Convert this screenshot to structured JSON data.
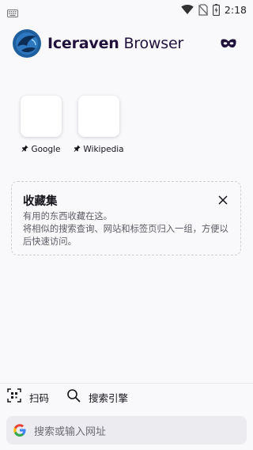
{
  "status_bar": {
    "time": "2:18",
    "icons": [
      "keyboard-icon",
      "wifi-icon",
      "no-sim-icon",
      "battery-icon"
    ]
  },
  "header": {
    "brand_bold": "Iceraven",
    "brand_rest": " Browser",
    "private_icon": "mask-icon"
  },
  "top_sites": [
    {
      "label": "Google",
      "pinned": true
    },
    {
      "label": "Wikipedia",
      "pinned": true
    }
  ],
  "collections": {
    "title": "收藏集",
    "description": "有用的东西收藏在这。\n将相似的搜索查询、网站和标签页归入一组，方便以后快速访问。"
  },
  "actions": {
    "scan_label": "扫码",
    "search_engine_label": "搜索引擎"
  },
  "address_bar": {
    "placeholder": "搜索或输入网址",
    "engine_icon": "google-icon"
  },
  "colors": {
    "background": "#f9f9fb",
    "brand_text": "#20123a",
    "dashed_border": "#cfcfd8",
    "address_bar_bg": "#ececf0"
  }
}
